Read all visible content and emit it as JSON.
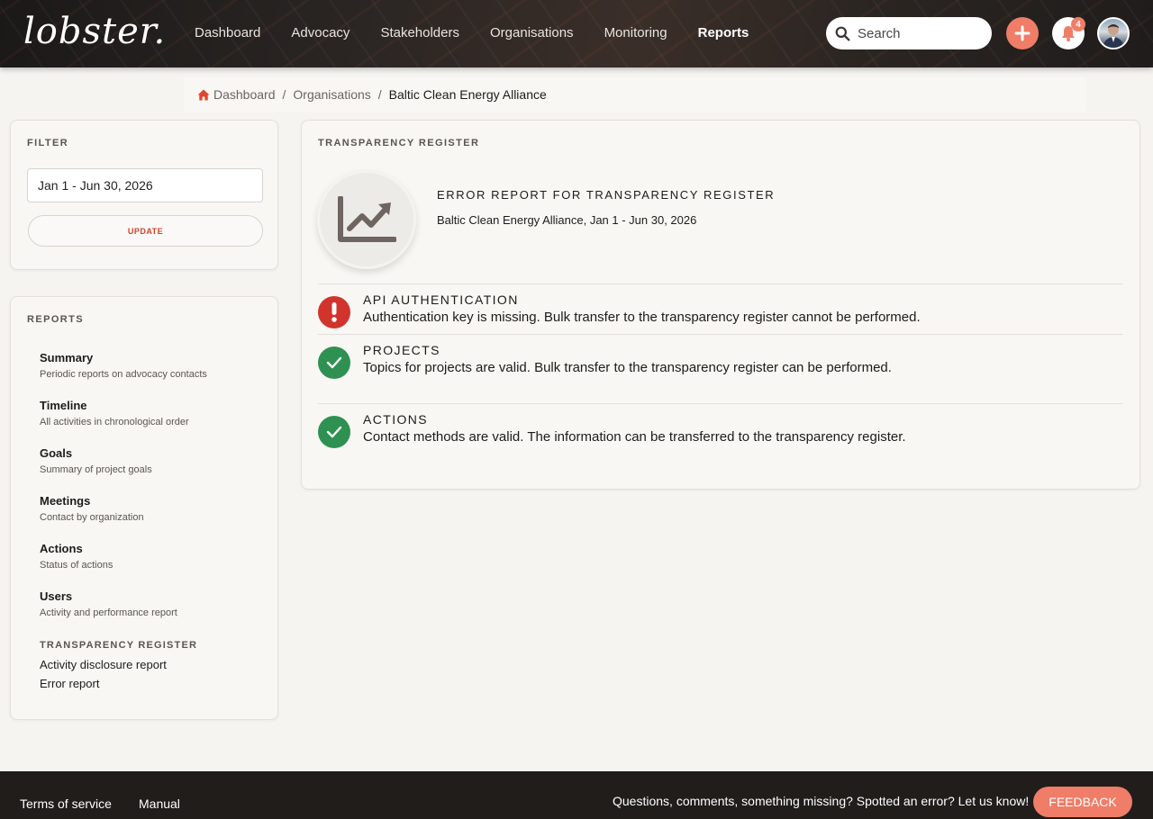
{
  "brand": {
    "logo_text": "lobster."
  },
  "nav": {
    "items": [
      {
        "label": "Dashboard"
      },
      {
        "label": "Advocacy"
      },
      {
        "label": "Stakeholders"
      },
      {
        "label": "Organisations"
      },
      {
        "label": "Monitoring"
      },
      {
        "label": "Reports"
      }
    ],
    "active": "Reports"
  },
  "search": {
    "placeholder": "Search"
  },
  "notifications": {
    "count": "4"
  },
  "breadcrumb": {
    "items": [
      "Dashboard",
      "Organisations"
    ],
    "current": "Baltic Clean Energy Alliance"
  },
  "filter": {
    "heading": "FILTER",
    "date_range": "Jan 1 - Jun 30, 2026",
    "update_label": "UPDATE"
  },
  "reports": {
    "heading": "REPORTS",
    "items": [
      {
        "title": "Summary",
        "desc": "Periodic reports on advocacy contacts"
      },
      {
        "title": "Timeline",
        "desc": "All activities in chronological order"
      },
      {
        "title": "Goals",
        "desc": "Summary of project goals"
      },
      {
        "title": "Meetings",
        "desc": "Contact by organization"
      },
      {
        "title": "Actions",
        "desc": "Status of actions"
      },
      {
        "title": "Users",
        "desc": "Activity and performance report"
      }
    ],
    "transparency_heading": "TRANSPARENCY REGISTER",
    "transparency_links": [
      "Activity disclosure report",
      "Error report"
    ]
  },
  "main": {
    "heading": "TRANSPARENCY REGISTER",
    "report_title": "ERROR REPORT FOR TRANSPARENCY REGISTER",
    "report_subtitle": "Baltic Clean Energy Alliance, Jan 1 - Jun 30, 2026",
    "results": [
      {
        "status": "error",
        "title": "API AUTHENTICATION",
        "message": "Authentication key is missing. Bulk transfer to the transparency register cannot be performed."
      },
      {
        "status": "ok",
        "title": "PROJECTS",
        "message": "Topics for projects are valid. Bulk transfer to the transparency register can be performed."
      },
      {
        "status": "ok",
        "title": "ACTIONS",
        "message": "Contact methods are valid. The information can be transferred to the transparency register."
      }
    ]
  },
  "footer": {
    "links": [
      "Terms of service",
      "Manual"
    ],
    "message": "Questions, comments, something missing? Spotted an error? Let us know!",
    "feedback_label": "FEEDBACK"
  },
  "colors": {
    "accent": "#ef7d68",
    "error": "#d0342c",
    "success": "#2f9151",
    "update_text": "#d0422d"
  },
  "icons": {
    "home": "home-icon",
    "search": "search-icon",
    "add": "plus-icon",
    "bell": "bell-icon",
    "chart": "chart-line-icon",
    "error": "exclamation-icon",
    "ok": "check-icon"
  }
}
